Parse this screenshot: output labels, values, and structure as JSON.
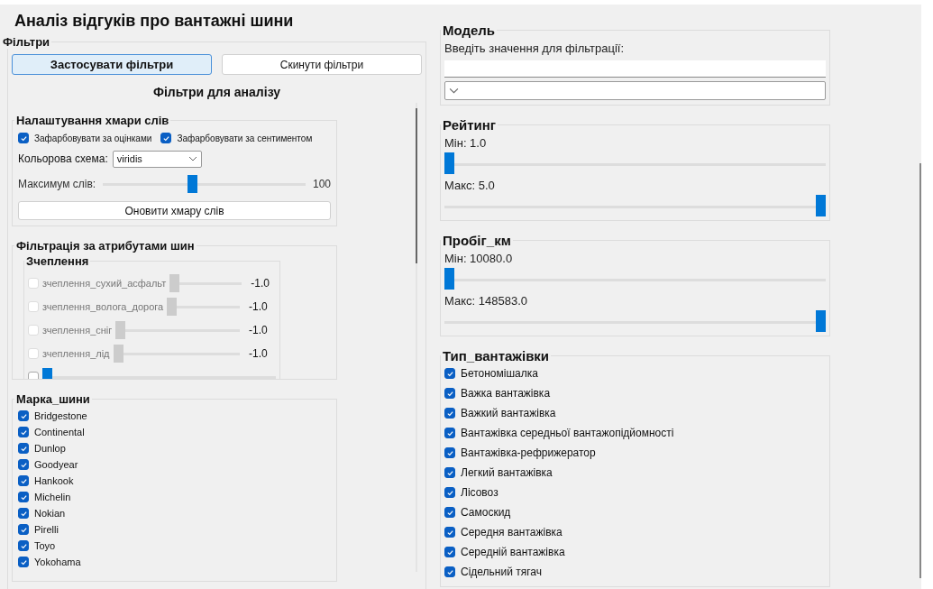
{
  "title": "Аналіз відгуків про вантажні шини",
  "filters": {
    "legend": "Фільтри",
    "buttons": [
      {
        "label": "Застосувати фільтри",
        "selected": true
      },
      {
        "label": "Скинути фільтри",
        "selected": false
      }
    ],
    "heading": "Фільтри для аналізу",
    "word_cloud": {
      "legend": "Налаштування хмари слів",
      "options": [
        {
          "label": "Зафарбовувати за оцінками",
          "checked": true
        },
        {
          "label": "Зафарбовувати за сентиментом",
          "checked": true
        }
      ],
      "color_scheme": {
        "label": "Кольорова схема:",
        "value": "viridis"
      },
      "max_words": {
        "label": "Максимум слів:",
        "level": 0.44,
        "reading": "100"
      },
      "button": "Оновити хмару слів"
    },
    "attributes": {
      "legend": "Фільтрація за атрибутами шин",
      "groups": [
        {
          "legend": "Зчеплення",
          "rows": [
            {
              "label": "зчеплення_сухий_асфальт",
              "checked": false,
              "disabled": true,
              "level": 0,
              "reading": "-1.0"
            },
            {
              "label": "зчеплення_волога_дорога",
              "checked": false,
              "disabled": true,
              "level": 0,
              "reading": "-1.0"
            },
            {
              "label": "зчеплення_сніг",
              "checked": false,
              "disabled": true,
              "level": 0,
              "reading": "-1.0"
            },
            {
              "label": "зчеплення_лід",
              "checked": false,
              "disabled": true,
              "level": 0,
              "reading": "-1.0"
            },
            {
              "checked": false,
              "disabled": false,
              "level": 0
            }
          ]
        }
      ]
    },
    "brand": {
      "legend": "Марка_шини",
      "items": [
        {
          "label": "Bridgestone",
          "checked": true
        },
        {
          "label": "Continental",
          "checked": true
        },
        {
          "label": "Dunlop",
          "checked": true
        },
        {
          "label": "Goodyear",
          "checked": true
        },
        {
          "label": "Hankook",
          "checked": true
        },
        {
          "label": "Michelin",
          "checked": true
        },
        {
          "label": "Nokian",
          "checked": true
        },
        {
          "label": "Pirelli",
          "checked": true
        },
        {
          "label": "Toyo",
          "checked": true
        },
        {
          "label": "Yokohama",
          "checked": true
        }
      ]
    }
  },
  "model": {
    "legend": "Модель",
    "prompt": "Введіть значення для фільтрації:"
  },
  "ranges": [
    {
      "legend": "Рейтинг",
      "min": {
        "label": "Мін: 1.0",
        "level": 0
      },
      "max": {
        "label": "Макс: 5.0",
        "level": 1
      }
    },
    {
      "legend": "Пробіг_км",
      "min": {
        "label": "Мін: 10080.0",
        "level": 0
      },
      "max": {
        "label": "Макс: 148583.0",
        "level": 1
      }
    }
  ],
  "truck_type": {
    "legend": "Тип_вантажівки",
    "items": [
      {
        "label": "Бетономішалка",
        "checked": true
      },
      {
        "label": "Важка вантажівка",
        "checked": true
      },
      {
        "label": "Важкий вантажівка",
        "checked": true
      },
      {
        "label": "Вантажівка середньої вантажопідйомності",
        "checked": true
      },
      {
        "label": "Вантажівка-рефрижератор",
        "checked": true
      },
      {
        "label": "Легкий вантажівка",
        "checked": true
      },
      {
        "label": "Лісовоз",
        "checked": true
      },
      {
        "label": "Самоскид",
        "checked": true
      },
      {
        "label": "Середня вантажівка",
        "checked": true
      },
      {
        "label": "Середній вантажівка",
        "checked": true
      },
      {
        "label": "Сідельний тягач",
        "checked": true
      }
    ]
  }
}
